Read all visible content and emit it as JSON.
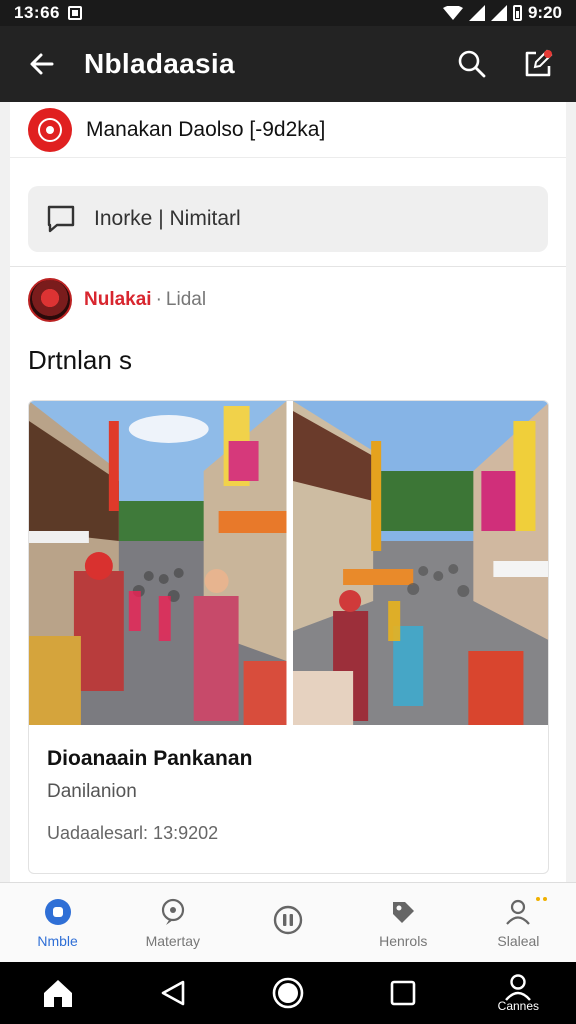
{
  "status_bar": {
    "time": "13:66",
    "battery_time": "9:20"
  },
  "app_bar": {
    "title": "Nbladaasia"
  },
  "channel": {
    "name": "Manakan Daolso [-9d2ka]"
  },
  "comment": {
    "placeholder": "Inorke | Nimitarl"
  },
  "post": {
    "author": "Nulakai",
    "separator": "·",
    "meta": "Lidal",
    "text": "Drtnlan s"
  },
  "media": {
    "title": "Dioanaain Pankanan",
    "subtitle": "Danilanion",
    "date": "Uadaalesarl: 13:9202"
  },
  "bottom_nav": [
    {
      "label": "Nmble",
      "icon": "home-circle-icon",
      "active": true
    },
    {
      "label": "Matertay",
      "icon": "chat-bubble-icon",
      "active": false
    },
    {
      "label": "",
      "icon": "pause-circle-icon",
      "active": false
    },
    {
      "label": "Henrols",
      "icon": "tag-icon",
      "active": false
    },
    {
      "label": "Slaleal",
      "icon": "profile-icon",
      "active": false
    }
  ],
  "system_nav": {
    "recents_label": "Cannes"
  },
  "colors": {
    "accent": "#2f6fd6",
    "brand_red": "#e02020",
    "app_bar": "#232323"
  }
}
